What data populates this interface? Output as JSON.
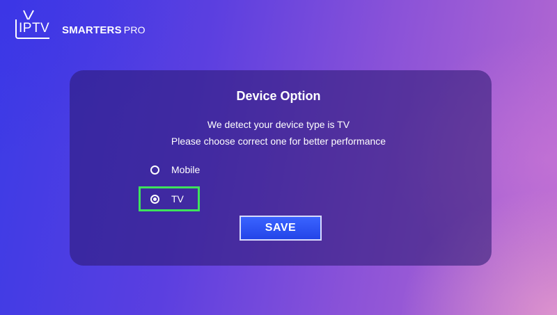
{
  "logo": {
    "iptv": "IPTV",
    "brand": "SMARTERS",
    "pro": "PRO"
  },
  "dialog": {
    "title": "Device Option",
    "line1": "We detect your device type is TV",
    "line2": "Please choose correct one for better performance",
    "options": [
      {
        "label": "Mobile",
        "selected": false
      },
      {
        "label": "TV",
        "selected": true,
        "focused": true
      }
    ],
    "save_label": "SAVE"
  },
  "colors": {
    "focus_border": "#3ee25c",
    "save_button": "#2f55f5"
  }
}
